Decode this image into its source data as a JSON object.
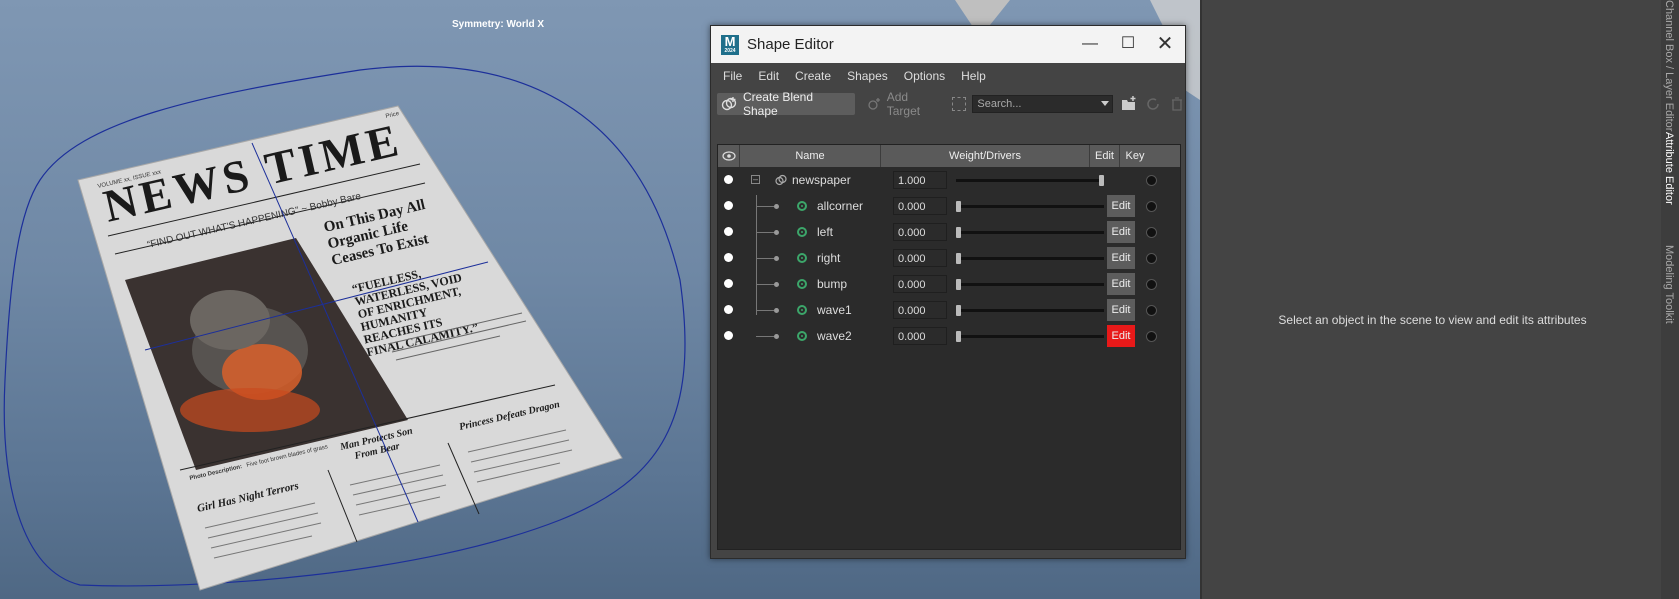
{
  "viewport": {
    "symmetry_label": "Symmetry: World X",
    "newspaper": {
      "headline": "NEWS TIME",
      "volume": "VOLUME xx, ISSUE xxx",
      "price": "Price",
      "tagline": "“FIND OUT WHAT'S HAPPENING” ~ Bobby Bare",
      "story_title": "On This Day All Organic Life Ceases To Exist",
      "quote": "“FUELLESS, WATERLESS, VOID OF ENRICHMENT, HUMANITY REACHES ITS FINAL CALAMITY.”",
      "photo_description_label": "Photo Description:",
      "photo_description": "Five foot brown blades of grass",
      "col1_title": "Girl Has Night Terrors",
      "col2_title": "Man Protects Son From Bear",
      "col3_title": "Princess Defeats Dragon"
    }
  },
  "shape_editor": {
    "app_icon": "M",
    "app_icon_sub": "2024",
    "title": "Shape Editor",
    "menu": [
      "File",
      "Edit",
      "Create",
      "Shapes",
      "Options",
      "Help"
    ],
    "toolbar": {
      "create_blend_shape": "Create Blend Shape",
      "add_target": "Add Target",
      "search_placeholder": "Search..."
    },
    "columns": {
      "name": "Name",
      "weight": "Weight/Drivers",
      "edit": "Edit",
      "key": "Key"
    },
    "group": {
      "name": "newspaper",
      "weight": "1.000",
      "slider_fraction": 1.0
    },
    "targets": [
      {
        "name": "allcorner",
        "weight": "0.000",
        "slider_fraction": 0.0,
        "edit_label": "Edit",
        "edit_active": false
      },
      {
        "name": "left",
        "weight": "0.000",
        "slider_fraction": 0.0,
        "edit_label": "Edit",
        "edit_active": false
      },
      {
        "name": "right",
        "weight": "0.000",
        "slider_fraction": 0.0,
        "edit_label": "Edit",
        "edit_active": false
      },
      {
        "name": "bump",
        "weight": "0.000",
        "slider_fraction": 0.0,
        "edit_label": "Edit",
        "edit_active": false
      },
      {
        "name": "wave1",
        "weight": "0.000",
        "slider_fraction": 0.0,
        "edit_label": "Edit",
        "edit_active": false
      },
      {
        "name": "wave2",
        "weight": "0.000",
        "slider_fraction": 0.0,
        "edit_label": "Edit",
        "edit_active": true
      }
    ],
    "colors": {
      "active_edit": "#e81919",
      "target_icon": "#3ca66a"
    }
  },
  "attribute_editor": {
    "message": "Select an object in the scene to view and edit its attributes"
  },
  "side_tabs": [
    "Channel Box / Layer Editor",
    "Attribute Editor",
    "Modeling Toolkit"
  ]
}
